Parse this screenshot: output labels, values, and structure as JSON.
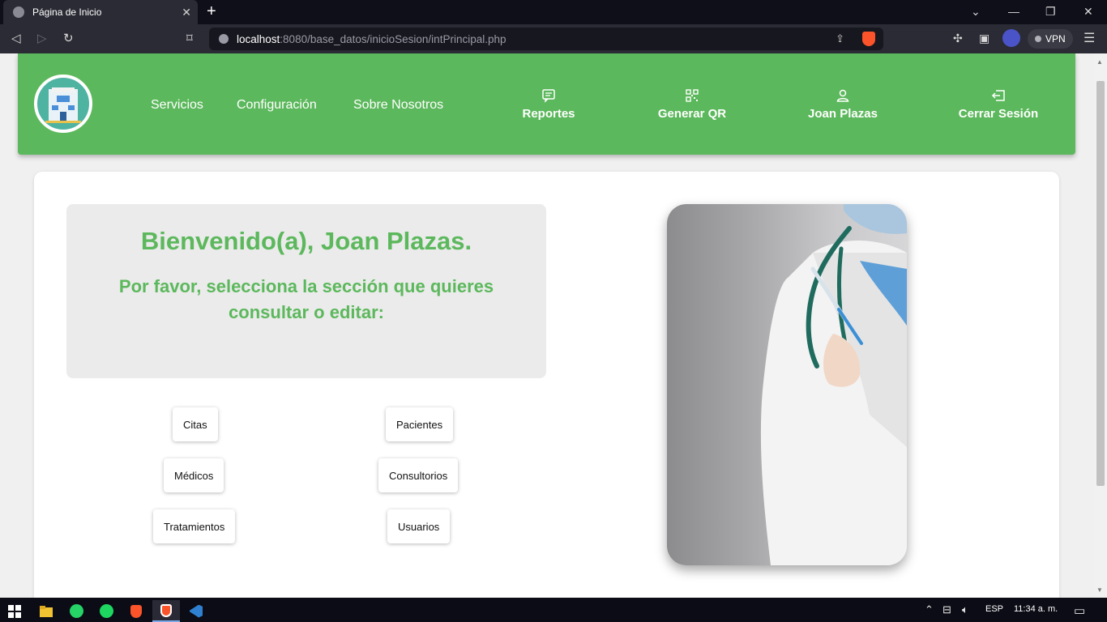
{
  "browser": {
    "tab_title": "Página de Inicio",
    "tab_close": "✕",
    "new_tab": "+",
    "url_host": "localhost",
    "url_rest": ":8080/base_datos/inicioSesion/intPrincipal.php",
    "vpn_label": "VPN"
  },
  "header": {
    "nav_links": {
      "servicios": "Servicios",
      "configuracion": "Configuración",
      "sobre_nosotros": "Sobre Nosotros"
    },
    "actions": {
      "reportes": "Reportes",
      "generar_qr": "Generar QR",
      "user_name": "Joan Plazas",
      "cerrar_sesion": "Cerrar Sesión"
    }
  },
  "main": {
    "welcome_title": "Bienvenido(a), Joan Plazas.",
    "welcome_subtitle": "Por favor, selecciona la sección que quieres consultar o editar:",
    "sections": {
      "citas": "Citas",
      "pacientes": "Pacientes",
      "medicos": "Médicos",
      "consultorios": "Consultorios",
      "tratamientos": "Tratamientos",
      "usuarios": "Usuarios"
    }
  },
  "taskbar": {
    "language": "ESP",
    "time": "11:34 a. m."
  },
  "colors": {
    "brand_green": "#5cb85c",
    "welcome_box": "#ebebeb",
    "logo_teal": "#4fb3a2"
  },
  "icons": [
    "globe-icon",
    "bookmark-icon",
    "share-icon",
    "brave-icon",
    "extensions-icon",
    "sidebar-icon",
    "menu-icon",
    "hospital-logo",
    "message-icon",
    "qr-code-icon",
    "user-icon",
    "logout-icon",
    "windows-icon",
    "file-explorer-icon",
    "whatsapp-icon",
    "spotify-icon",
    "vscode-icon",
    "notification-icon"
  ]
}
